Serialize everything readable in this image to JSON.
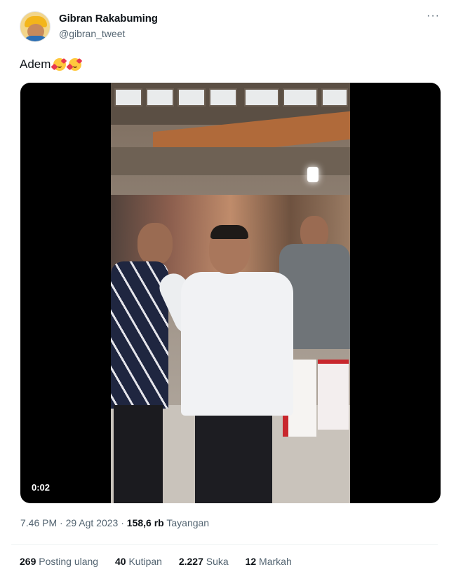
{
  "user": {
    "name": "Gibran Rakabuming",
    "handle": "@gibran_tweet"
  },
  "menu_icon": "more-horizontal-icon",
  "more_glyph": "···",
  "tweet": {
    "text": "Adem",
    "emoji": [
      "smiling-face-with-hearts-icon",
      "smiling-face-with-hearts-icon"
    ]
  },
  "video": {
    "duration": "0:02"
  },
  "meta": {
    "time": "7.46 PM",
    "separator": "·",
    "date": "29 Agt 2023",
    "views_count": "158,6 rb",
    "views_label": "Tayangan"
  },
  "stats": [
    {
      "count": "269",
      "label": "Posting ulang"
    },
    {
      "count": "40",
      "label": "Kutipan"
    },
    {
      "count": "2.227",
      "label": "Suka"
    },
    {
      "count": "12",
      "label": "Markah"
    }
  ],
  "colors": {
    "text_primary": "#0f1419",
    "text_secondary": "#536471",
    "divider": "#eff3f4"
  }
}
